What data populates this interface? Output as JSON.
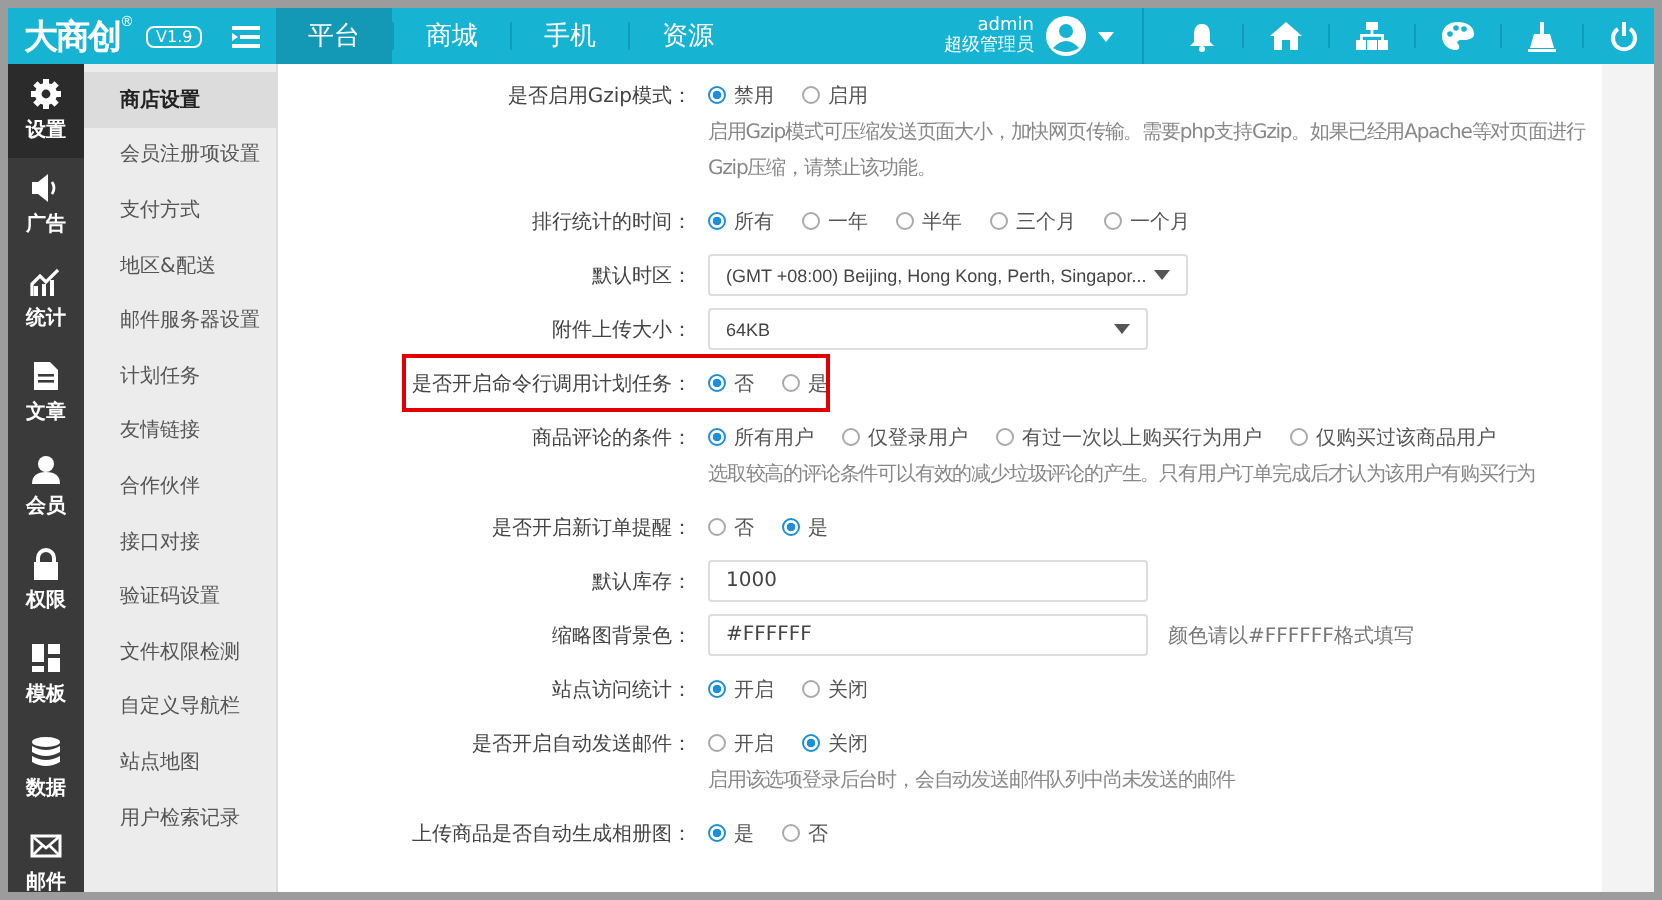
{
  "logo": {
    "text": "大商创",
    "mark": "®",
    "version": "V1.9"
  },
  "nav_tabs": [
    {
      "label": "平台",
      "selected": true
    },
    {
      "label": "商城",
      "selected": false
    },
    {
      "label": "手机",
      "selected": false
    },
    {
      "label": "资源",
      "selected": false
    }
  ],
  "user": {
    "name": "admin",
    "role": "超级管理员"
  },
  "sidebar": [
    {
      "label": "设置",
      "selected": true
    },
    {
      "label": "广告",
      "selected": false
    },
    {
      "label": "统计",
      "selected": false
    },
    {
      "label": "文章",
      "selected": false
    },
    {
      "label": "会员",
      "selected": false
    },
    {
      "label": "权限",
      "selected": false
    },
    {
      "label": "模板",
      "selected": false
    },
    {
      "label": "数据",
      "selected": false
    },
    {
      "label": "邮件",
      "selected": false
    }
  ],
  "submenu": [
    {
      "label": "商店设置",
      "selected": true
    },
    {
      "label": "会员注册项设置",
      "selected": false
    },
    {
      "label": "支付方式",
      "selected": false
    },
    {
      "label": "地区&配送",
      "selected": false
    },
    {
      "label": "邮件服务器设置",
      "selected": false
    },
    {
      "label": "计划任务",
      "selected": false
    },
    {
      "label": "友情链接",
      "selected": false
    },
    {
      "label": "合作伙伴",
      "selected": false
    },
    {
      "label": "接口对接",
      "selected": false
    },
    {
      "label": "验证码设置",
      "selected": false
    },
    {
      "label": "文件权限检测",
      "selected": false
    },
    {
      "label": "自定义导航栏",
      "selected": false
    },
    {
      "label": "站点地图",
      "selected": false
    },
    {
      "label": "用户检索记录",
      "selected": false
    }
  ],
  "settings": [
    {
      "kind": "radio",
      "label": "是否启用Gzip模式：",
      "options": [
        {
          "label": "禁用",
          "selected": true
        },
        {
          "label": "启用",
          "selected": false
        }
      ],
      "help": "启用Gzip模式可压缩发送页面大小，加快网页传输。需要php支持Gzip。如果已经用Apache等对页面进行Gzip压缩，请禁止该功能。"
    },
    {
      "kind": "radio",
      "label": "排行统计的时间：",
      "options": [
        {
          "label": "所有",
          "selected": true
        },
        {
          "label": "一年",
          "selected": false
        },
        {
          "label": "半年",
          "selected": false
        },
        {
          "label": "三个月",
          "selected": false
        },
        {
          "label": "一个月",
          "selected": false
        }
      ]
    },
    {
      "kind": "select",
      "label": "默认时区：",
      "value": "(GMT +08:00) Beijing, Hong Kong, Perth, Singapor..."
    },
    {
      "kind": "select",
      "label": "附件上传大小：",
      "value": "64KB"
    },
    {
      "kind": "radio",
      "label": "是否开启命令行调用计划任务：",
      "highlighted": true,
      "options": [
        {
          "label": "否",
          "selected": true
        },
        {
          "label": "是",
          "selected": false
        }
      ]
    },
    {
      "kind": "radio",
      "label": "商品评论的条件：",
      "options": [
        {
          "label": "所有用户",
          "selected": true
        },
        {
          "label": "仅登录用户",
          "selected": false
        },
        {
          "label": "有过一次以上购买行为用户",
          "selected": false
        },
        {
          "label": "仅购买过该商品用户",
          "selected": false
        }
      ],
      "help": "选取较高的评论条件可以有效的减少垃圾评论的产生。只有用户订单完成后才认为该用户有购买行为"
    },
    {
      "kind": "radio",
      "label": "是否开启新订单提醒：",
      "options": [
        {
          "label": "否",
          "selected": false
        },
        {
          "label": "是",
          "selected": true
        }
      ]
    },
    {
      "kind": "input",
      "label": "默认库存：",
      "value": "1000"
    },
    {
      "kind": "input",
      "label": "缩略图背景色：",
      "value": "#FFFFFF",
      "note": "颜色请以#FFFFFF格式填写"
    },
    {
      "kind": "radio",
      "label": "站点访问统计：",
      "options": [
        {
          "label": "开启",
          "selected": true
        },
        {
          "label": "关闭",
          "selected": false
        }
      ]
    },
    {
      "kind": "radio",
      "label": "是否开启自动发送邮件：",
      "options": [
        {
          "label": "开启",
          "selected": false
        },
        {
          "label": "关闭",
          "selected": true
        }
      ],
      "help": "启用该选项登录后台时，会自动发送邮件队列中尚未发送的邮件"
    },
    {
      "kind": "radio",
      "label": "上传商品是否自动生成相册图：",
      "options": [
        {
          "label": "是",
          "selected": true
        },
        {
          "label": "否",
          "selected": false
        }
      ]
    }
  ]
}
